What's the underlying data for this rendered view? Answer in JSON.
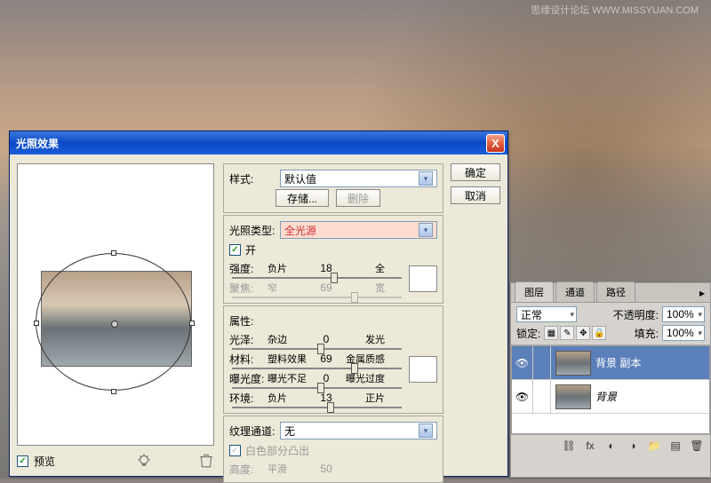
{
  "watermark": "思缘设计论坛  WWW.MISSYUAN.COM",
  "dialog": {
    "title": "光照效果",
    "close": "X",
    "ok": "确定",
    "cancel": "取消",
    "preview_label": "预览",
    "style": {
      "label": "样式:",
      "value": "默认值",
      "save": "存储...",
      "delete": "删除"
    },
    "light_type": {
      "label": "光照类型:",
      "value": "全光源",
      "on_label": "开"
    },
    "intensity": {
      "label": "强度:",
      "left": "负片",
      "value": "18",
      "right": "全",
      "pos": 58
    },
    "focus": {
      "label": "聚焦:",
      "left": "窄",
      "value": "69",
      "right": "宽",
      "pos": 70,
      "disabled": true
    },
    "properties_label": "属性:",
    "gloss": {
      "label": "光泽:",
      "left": "杂边",
      "value": "0",
      "right": "发光",
      "pos": 50
    },
    "material": {
      "label": "材料:",
      "left": "塑料效果",
      "value": "69",
      "right": "金属质感",
      "pos": 70
    },
    "exposure": {
      "label": "曝光度:",
      "left": "曝光不足",
      "value": "0",
      "right": "曝光过度",
      "pos": 50
    },
    "ambience": {
      "label": "环境:",
      "left": "负片",
      "value": "13",
      "right": "正片",
      "pos": 56
    },
    "texture": {
      "label": "纹理通道:",
      "value": "无"
    },
    "white_high": "白色部分凸出",
    "height": {
      "label": "高度:",
      "left": "平滑",
      "value": "50",
      "right": "",
      "pos": 50,
      "disabled": true
    }
  },
  "layers": {
    "tabs": {
      "layers": "图层",
      "channels": "通道",
      "paths": "路径"
    },
    "blend_mode": "正常",
    "opacity_label": "不透明度:",
    "opacity_value": "100%",
    "lock_label": "锁定:",
    "fill_label": "填充:",
    "fill_value": "100%",
    "items": [
      {
        "name": "背景 副本",
        "selected": true
      },
      {
        "name": "背景",
        "selected": false,
        "italic": true
      }
    ]
  }
}
